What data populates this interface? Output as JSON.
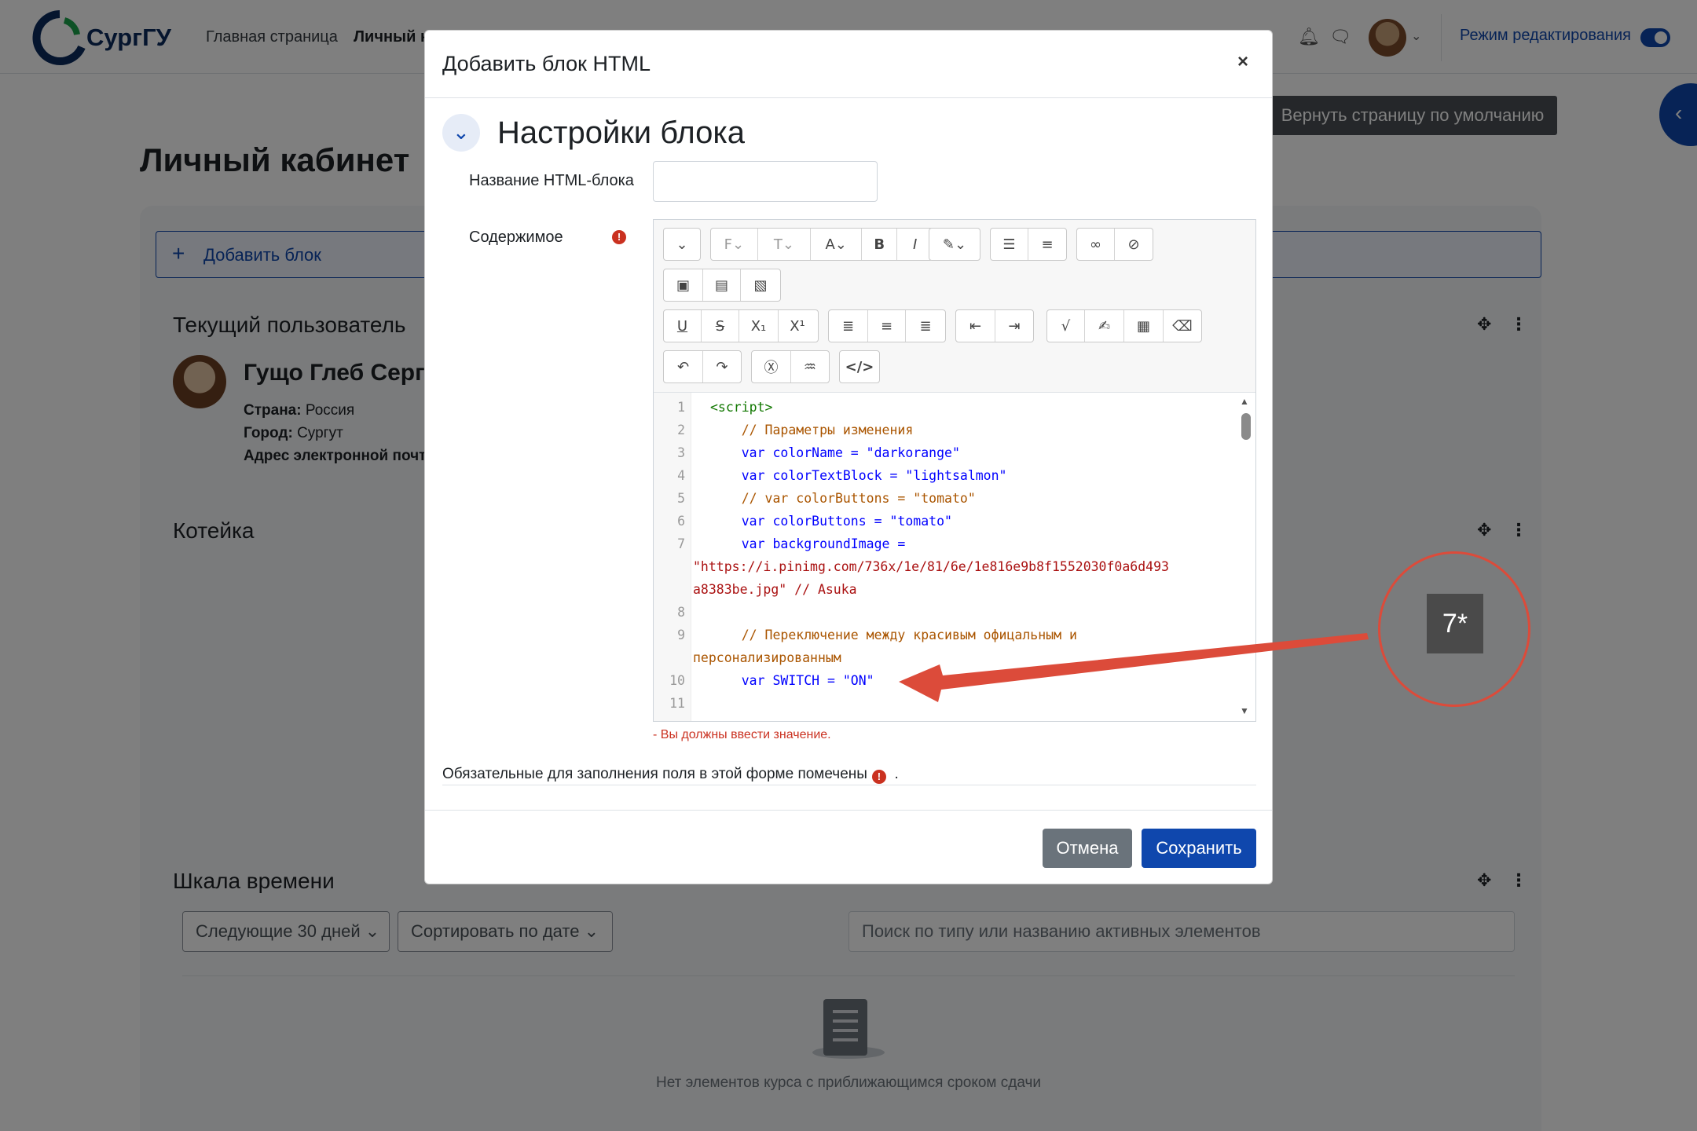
{
  "app": {
    "brand": "СургГУ",
    "nav": [
      "Главная страница",
      "Личный к"
    ],
    "edit_mode_label": "Режим редактирования",
    "reset_page_label": "Вернуть страницу по умолчанию"
  },
  "page": {
    "title": "Личный кабинет",
    "add_block_label": "Добавить блок"
  },
  "blocks": {
    "current_user": {
      "title": "Текущий пользователь",
      "name": "Гущо Глеб Серге",
      "country_label": "Страна:",
      "country_value": "Россия",
      "city_label": "Город:",
      "city_value": "Сургут",
      "email_label": "Адрес электронной почт"
    },
    "koteika": {
      "title": "Котейка"
    },
    "timeline": {
      "title": "Шкала времени",
      "range_select": "Следующие 30 дней",
      "sort_select": "Сортировать по дате",
      "search_placeholder": "Поиск по типу или названию активных элементов",
      "empty_text": "Нет элементов курса с приближающимся сроком сдачи"
    }
  },
  "modal": {
    "title": "Добавить блок HTML",
    "close": "×",
    "section_title": "Настройки блока",
    "name_label": "Название HTML-блока",
    "content_label": "Содержимое",
    "error_text": "- Вы должны ввести значение.",
    "required_note": "Обязательные для заполнения поля в этой форме помечены",
    "required_note_end": ".",
    "cancel_label": "Отмена",
    "save_label": "Сохранить",
    "code_lines": [
      {
        "n": "1",
        "text": "<script>"
      },
      {
        "n": "2",
        "text": "    // Параметры изменения"
      },
      {
        "n": "3",
        "text": "    var colorName = \"darkorange\""
      },
      {
        "n": "4",
        "text": "    var colorTextBlock = \"lightsalmon\""
      },
      {
        "n": "5",
        "text": "    // var colorButtons = \"tomato\""
      },
      {
        "n": "6",
        "text": "    var colorButtons = \"tomato\""
      },
      {
        "n": "7",
        "text": "    var backgroundImage ="
      },
      {
        "n": "",
        "text": "\"https://i.pinimg.com/736x/1e/81/6e/1e816e9b8f1552030f0a6d493"
      },
      {
        "n": "",
        "text": "a8383be.jpg\" // Asuka"
      },
      {
        "n": "8",
        "text": ""
      },
      {
        "n": "9",
        "text": "    // Переключение между красивым офицальным и"
      },
      {
        "n": "",
        "text": "персонализированным"
      },
      {
        "n": "10",
        "text": "    var SWITCH = \"ON\""
      },
      {
        "n": "11",
        "text": ""
      }
    ]
  },
  "annotation": {
    "badge": "7*",
    "color": "#dc4b3a"
  },
  "colors": {
    "primary": "#0f47ad",
    "danger": "#ca3120",
    "secondary": "#6a737b"
  }
}
